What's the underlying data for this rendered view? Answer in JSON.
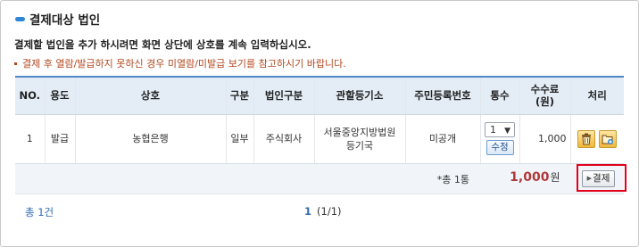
{
  "title": "결제대상 법인",
  "instruction": "결제할 법인을 추가 하시려면 화면 상단에 상호를 계속 입력하십시오.",
  "note": "결제 후 열람/발급하지 못하신 경우 미열람/미발급 보기를 참고하시기 바랍니다.",
  "table": {
    "headers": {
      "no": "NO.",
      "usage": "용도",
      "name": "상호",
      "type": "구분",
      "corp_type": "법인구분",
      "registry": "관할등기소",
      "resident_no": "주민등록번호",
      "copies": "통수",
      "fee": "수수료\n(원)",
      "action": "처리"
    },
    "rows": [
      {
        "no": "1",
        "usage": "발급",
        "name": "농협은행",
        "type": "일부",
        "corp_type": "주식회사",
        "registry": "서울중앙지방법원 등기국",
        "resident_no": "미공개",
        "copies": "1",
        "edit_label": "수정",
        "fee": "1,000",
        "delete_icon": "trash-icon",
        "add_icon": "folder-add-icon"
      }
    ]
  },
  "summary": {
    "count": "*총 1통",
    "amount": "1,000",
    "unit": "원",
    "pay_button": "결제"
  },
  "footer": {
    "total": "총 1건",
    "current_page": "1",
    "page_info": "(1/1)"
  },
  "colors": {
    "accent": "#2f86d8",
    "header_bg": "#e4edf6",
    "amount": "#b03a3a",
    "note": "#b3471e",
    "highlight": "#e3001b"
  }
}
